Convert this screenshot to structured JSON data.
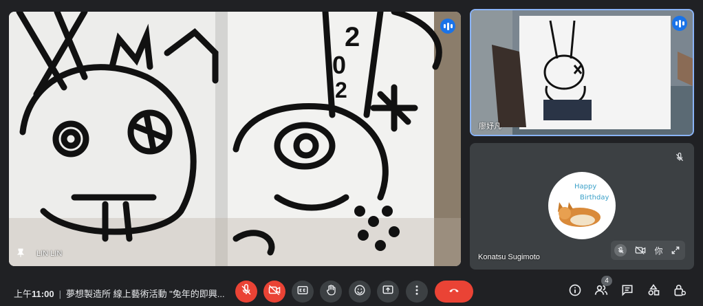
{
  "participants": {
    "main": {
      "name": "LIN LIN"
    },
    "side1": {
      "name": "廖妤凡"
    },
    "side2": {
      "name": "Konatsu Sugimoto",
      "self_label": "你",
      "avatar_text": [
        "Happy",
        "Birthday"
      ]
    }
  },
  "meeting": {
    "time_prefix": "上午",
    "time": "11:00",
    "separator": "|",
    "title": "夢想製造所 線上藝術活動 \"兔年的即興..."
  },
  "people_count": "4",
  "icons": {
    "mic_off": "mic-off-icon",
    "camera_off": "camera-off-icon",
    "captions": "captions-icon",
    "raise_hand": "hand-icon",
    "emoji": "emoji-icon",
    "present": "present-icon",
    "more": "more-vert-icon",
    "end_call": "end-call-icon",
    "info": "info-icon",
    "people": "people-icon",
    "chat": "chat-icon",
    "activities": "shapes-icon",
    "host_controls": "lock-person-icon"
  },
  "colors": {
    "accent": "#1a73e8",
    "danger": "#ea4335",
    "bar": "#202124",
    "tile": "#3c4043"
  }
}
